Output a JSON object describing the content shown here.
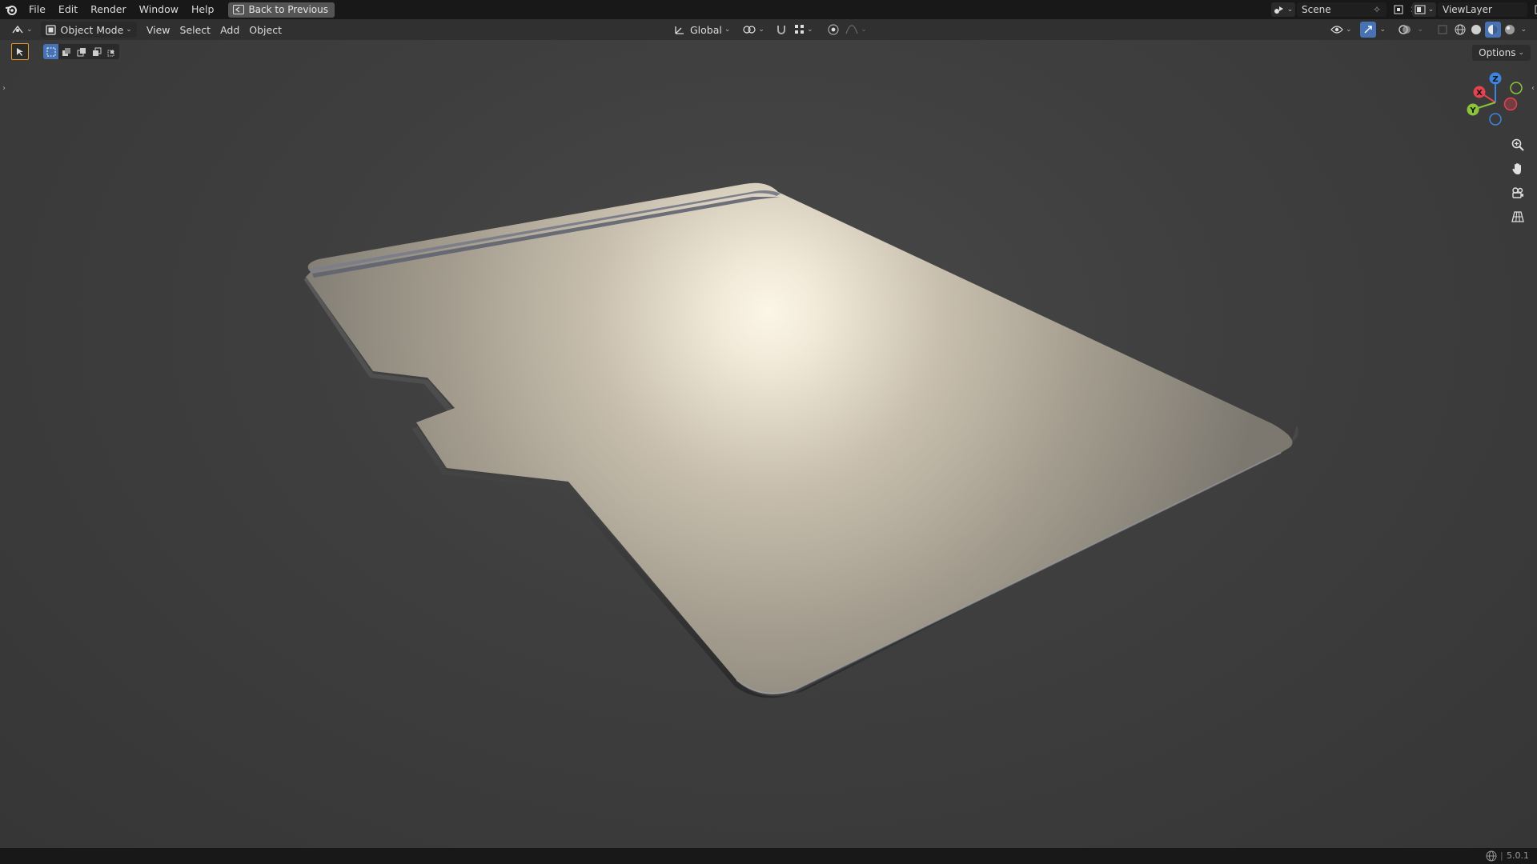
{
  "menu": {
    "file": "File",
    "edit": "Edit",
    "render": "Render",
    "window": "Window",
    "help": "Help",
    "back_button": "Back to Previous"
  },
  "scene": {
    "label": "Scene"
  },
  "view_layer": {
    "label": "ViewLayer"
  },
  "header": {
    "mode": "Object Mode",
    "view": "View",
    "select": "Select",
    "add": "Add",
    "object": "Object",
    "orientation": "Global"
  },
  "viewport": {
    "options": "Options",
    "gizmo": {
      "x": "X",
      "y": "Y",
      "z": "Z"
    }
  },
  "status": {
    "version": "5.0.1"
  },
  "colors": {
    "topbar": "#181818",
    "header": "#303030",
    "viewport": "#3d3d3d",
    "axis_x": "#e2434f",
    "axis_y": "#8bc43a",
    "axis_z": "#3b85e0",
    "active_blue": "#4772b3"
  },
  "icons": [
    "blender-logo-icon",
    "back-icon",
    "editor-type-icon",
    "object-mode-icon",
    "select-box-icon",
    "transform-orientation-icon",
    "pivot-icon",
    "snap-icon",
    "proportional-edit-icon",
    "visibility-icon",
    "gizmo-icon",
    "overlay-icon",
    "xray-icon",
    "shading-wireframe-icon",
    "shading-solid-icon",
    "shading-material-icon",
    "shading-rendered-icon",
    "zoom-icon",
    "pan-hand-icon",
    "camera-icon",
    "grid-icon"
  ]
}
